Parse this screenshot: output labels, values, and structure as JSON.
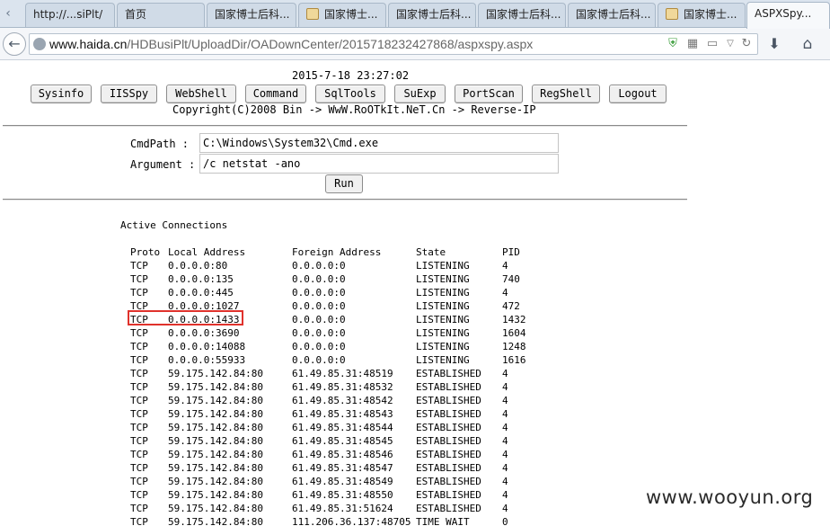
{
  "browser": {
    "tabs": [
      {
        "label": "http://...siPlt/",
        "favicon": false
      },
      {
        "label": "首页",
        "favicon": false
      },
      {
        "label": "国家博士后科...",
        "favicon": false
      },
      {
        "label": "国家博士...",
        "favicon": true
      },
      {
        "label": "国家博士后科...",
        "favicon": false
      },
      {
        "label": "国家博士后科...",
        "favicon": false
      },
      {
        "label": "国家博士后科...",
        "favicon": false
      },
      {
        "label": "国家博士...",
        "favicon": true
      },
      {
        "label": "ASPXSpy...",
        "favicon": false,
        "active": true
      }
    ],
    "url_host": "www.haida.cn",
    "url_path": "/HDBusiPlt/UploadDir/OADownCenter/2015718232427868/aspxspy.aspx"
  },
  "page": {
    "datetime": "2015-7-18 23:27:02",
    "nav_buttons": [
      "Sysinfo",
      "IISSpy",
      "WebShell",
      "Command",
      "SqlTools",
      "SuExp",
      "PortScan",
      "RegShell",
      "Logout"
    ],
    "copyright": "Copyright(C)2008 Bin -> WwW.RoOTkIt.NeT.Cn -> Reverse-IP",
    "cmdpath_label": "CmdPath :",
    "cmdpath_value": "C:\\Windows\\System32\\Cmd.exe",
    "argument_label": "Argument :",
    "argument_value": "/c netstat -ano",
    "run_label": "Run"
  },
  "netstat": {
    "title": "Active Connections",
    "headers": [
      "Proto",
      "Local Address",
      "Foreign Address",
      "State",
      "PID"
    ],
    "rows": [
      [
        "TCP",
        "0.0.0.0:80",
        "0.0.0.0:0",
        "LISTENING",
        "4"
      ],
      [
        "TCP",
        "0.0.0.0:135",
        "0.0.0.0:0",
        "LISTENING",
        "740"
      ],
      [
        "TCP",
        "0.0.0.0:445",
        "0.0.0.0:0",
        "LISTENING",
        "4"
      ],
      [
        "TCP",
        "0.0.0.0:1027",
        "0.0.0.0:0",
        "LISTENING",
        "472"
      ],
      [
        "TCP",
        "0.0.0.0:1433",
        "0.0.0.0:0",
        "LISTENING",
        "1432"
      ],
      [
        "TCP",
        "0.0.0.0:3690",
        "0.0.0.0:0",
        "LISTENING",
        "1604"
      ],
      [
        "TCP",
        "0.0.0.0:14088",
        "0.0.0.0:0",
        "LISTENING",
        "1248"
      ],
      [
        "TCP",
        "0.0.0.0:55933",
        "0.0.0.0:0",
        "LISTENING",
        "1616"
      ],
      [
        "TCP",
        "59.175.142.84:80",
        "61.49.85.31:48519",
        "ESTABLISHED",
        "4"
      ],
      [
        "TCP",
        "59.175.142.84:80",
        "61.49.85.31:48532",
        "ESTABLISHED",
        "4"
      ],
      [
        "TCP",
        "59.175.142.84:80",
        "61.49.85.31:48542",
        "ESTABLISHED",
        "4"
      ],
      [
        "TCP",
        "59.175.142.84:80",
        "61.49.85.31:48543",
        "ESTABLISHED",
        "4"
      ],
      [
        "TCP",
        "59.175.142.84:80",
        "61.49.85.31:48544",
        "ESTABLISHED",
        "4"
      ],
      [
        "TCP",
        "59.175.142.84:80",
        "61.49.85.31:48545",
        "ESTABLISHED",
        "4"
      ],
      [
        "TCP",
        "59.175.142.84:80",
        "61.49.85.31:48546",
        "ESTABLISHED",
        "4"
      ],
      [
        "TCP",
        "59.175.142.84:80",
        "61.49.85.31:48547",
        "ESTABLISHED",
        "4"
      ],
      [
        "TCP",
        "59.175.142.84:80",
        "61.49.85.31:48549",
        "ESTABLISHED",
        "4"
      ],
      [
        "TCP",
        "59.175.142.84:80",
        "61.49.85.31:48550",
        "ESTABLISHED",
        "4"
      ],
      [
        "TCP",
        "59.175.142.84:80",
        "61.49.85.31:51624",
        "ESTABLISHED",
        "4"
      ],
      [
        "TCP",
        "59.175.142.84:80",
        "111.206.36.137:48705",
        "TIME_WAIT",
        "0"
      ]
    ]
  },
  "watermark": "www.wooyun.org",
  "colors": {
    "highlight": "#e0322c",
    "tab_strip": "#dbe4ee"
  },
  "icons": [
    "globe-icon",
    "shield-icon",
    "qr-icon",
    "reader-icon",
    "dropdown-icon",
    "reload-icon",
    "download-icon",
    "home-icon",
    "back-icon"
  ]
}
